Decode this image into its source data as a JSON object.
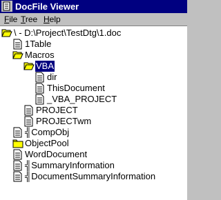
{
  "window": {
    "title": "DocFile Viewer"
  },
  "menu": [
    {
      "mnemonic": "F",
      "rest": "ile"
    },
    {
      "mnemonic": "T",
      "rest": "ree"
    },
    {
      "mnemonic": "H",
      "rest": "elp"
    }
  ],
  "tree": {
    "root": {
      "label": "\\ - D:\\Project\\TestDtg\\1.doc",
      "icon": "open-folder-icon"
    },
    "nodes": [
      {
        "label": "1Table",
        "icon": "document-icon"
      },
      {
        "label": "Macros",
        "icon": "open-folder-icon"
      },
      {
        "label": "VBA",
        "icon": "open-folder-icon",
        "selected": true
      },
      {
        "label": "dir",
        "icon": "document-icon"
      },
      {
        "label": "ThisDocument",
        "icon": "document-icon"
      },
      {
        "label": "_VBA_PROJECT",
        "icon": "document-icon"
      },
      {
        "label": "PROJECT",
        "icon": "document-icon"
      },
      {
        "label": "PROJECTwm",
        "icon": "document-icon"
      },
      {
        "label": "╣CompObj",
        "icon": "document-icon"
      },
      {
        "label": "ObjectPool",
        "icon": "closed-folder-icon"
      },
      {
        "label": "WordDocument",
        "icon": "document-icon"
      },
      {
        "label": "╣SummaryInformation",
        "icon": "document-icon"
      },
      {
        "label": "╣DocumentSummaryInformation",
        "icon": "document-icon"
      }
    ]
  },
  "colors": {
    "title_bar": "#000080",
    "selection": "#000080",
    "folder": "#ffff00",
    "chrome": "#c0c0c0"
  }
}
